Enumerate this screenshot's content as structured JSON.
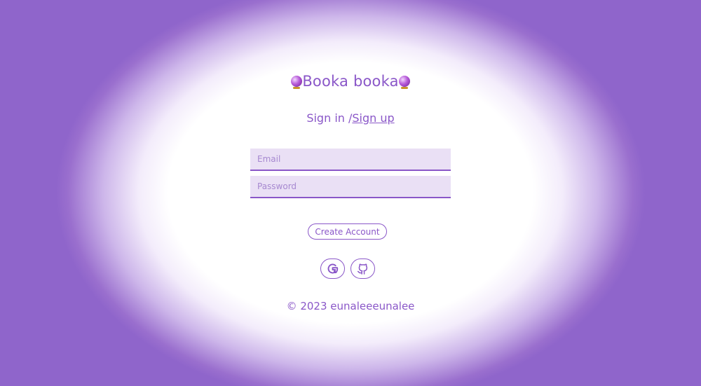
{
  "app": {
    "title": "Booka booka",
    "title_icon": "crystal-ball-icon"
  },
  "auth": {
    "signin_label": "Sign in /",
    "signup_label": "Sign up"
  },
  "form": {
    "email_placeholder": "Email",
    "email_value": "",
    "password_placeholder": "Password",
    "password_value": "",
    "submit_label": "Create Account"
  },
  "social": {
    "google_icon": "google-icon",
    "github_icon": "github-icon"
  },
  "footer": {
    "copyright": "© 2023 eunaleeeunalee"
  },
  "colors": {
    "background": "#8f65cb",
    "accent": "#8a57c8",
    "input_bg": "#eae0f5"
  }
}
